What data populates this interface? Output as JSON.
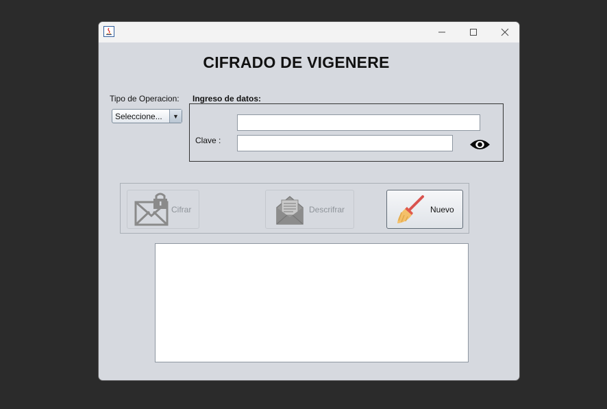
{
  "window": {
    "title": "",
    "controls": [
      "minimize-icon",
      "maximize-icon",
      "close-icon"
    ]
  },
  "main": {
    "heading": "CIFRADO DE VIGENERE",
    "tipo_operacion_label": "Tipo de Operacion:",
    "tipo_operacion_selected": "Seleccione...",
    "ingreso_label": "Ingreso de datos:",
    "text_input_value": "",
    "clave_label": "Clave :",
    "clave_value": ""
  },
  "buttons": {
    "cifrar": {
      "label": "Cifrar",
      "enabled": false,
      "icon": "envelope-lock-icon"
    },
    "descifrar": {
      "label": "Descrifrar",
      "enabled": false,
      "icon": "open-envelope-icon"
    },
    "nuevo": {
      "label": "Nuevo",
      "enabled": true,
      "icon": "broom-icon"
    }
  },
  "output": {
    "text": ""
  },
  "colors": {
    "window_bg": "#d6d9df",
    "desktop_bg": "#2b2b2b",
    "disabled_text": "#8f949a"
  }
}
